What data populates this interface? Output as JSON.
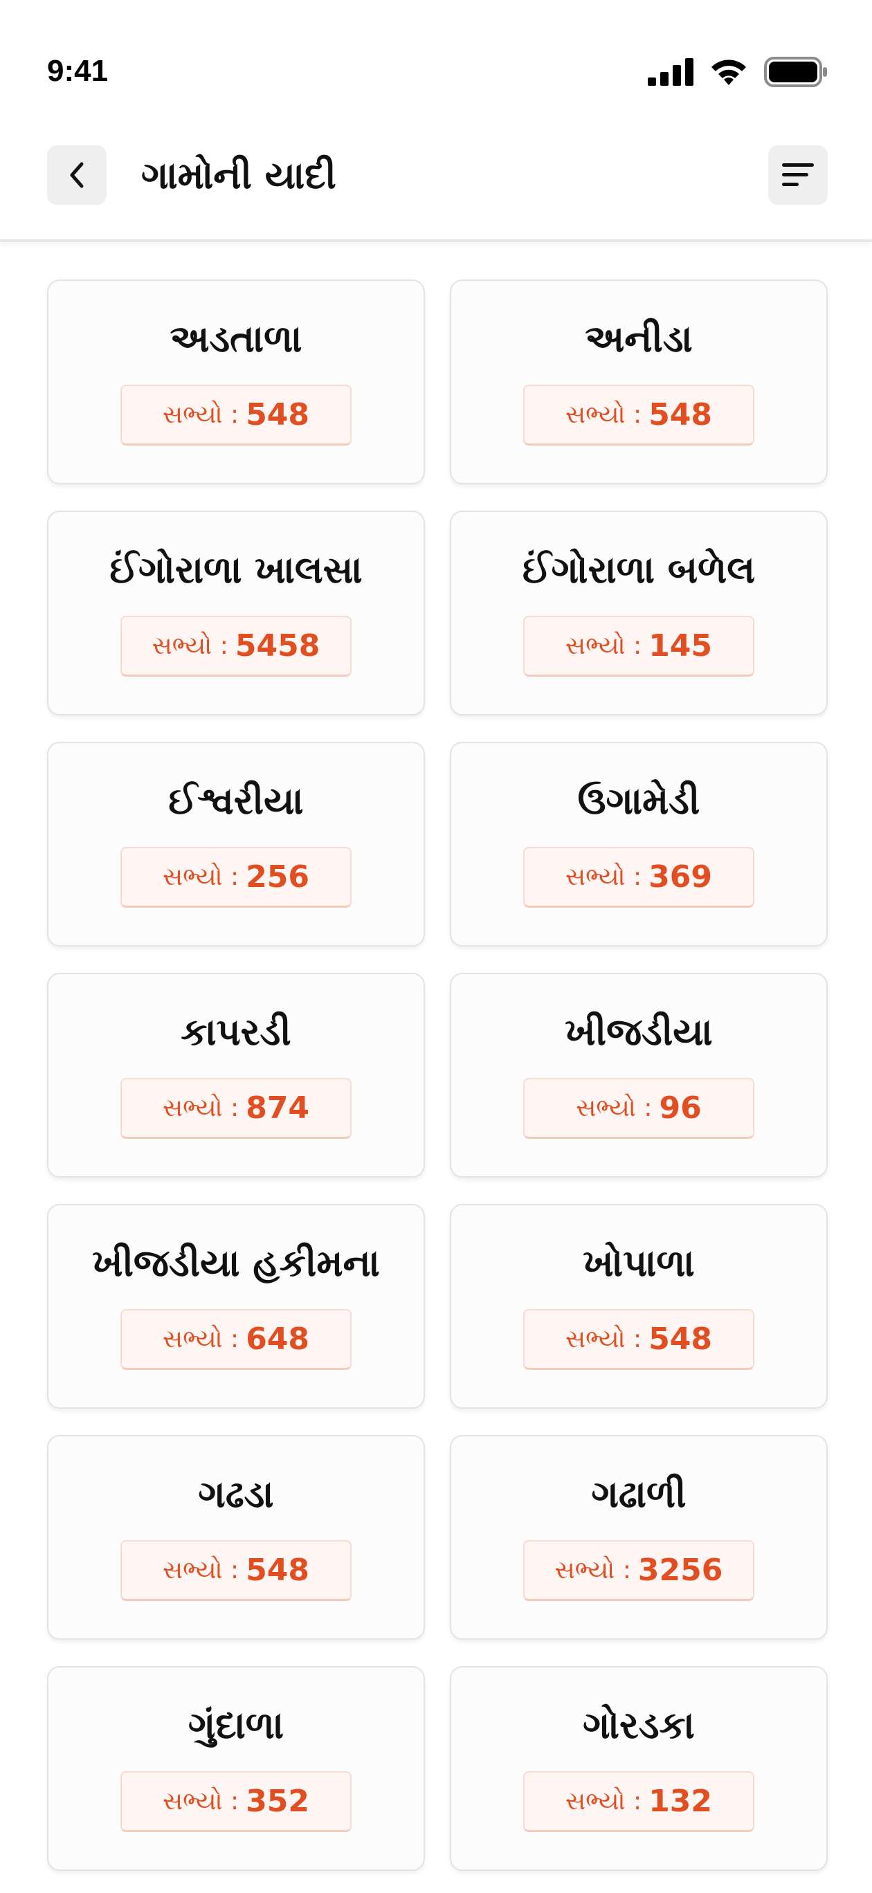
{
  "status_bar": {
    "time": "9:41"
  },
  "header": {
    "title": "ગામોની યાદી"
  },
  "colors": {
    "accent": "#e04e22",
    "count_bg": "#fff5f2",
    "button_bg": "#efefef"
  },
  "villages": [
    {
      "name": "અડતાળા",
      "members_label": "સભ્યો :",
      "members": "548"
    },
    {
      "name": "અનીડા",
      "members_label": "સભ્યો :",
      "members": "548"
    },
    {
      "name": "ઈંગોરાળા ખાલસા",
      "members_label": "સભ્યો :",
      "members": "5458"
    },
    {
      "name": "ઈંગોરાળા બળેલ",
      "members_label": "સભ્યો :",
      "members": "145"
    },
    {
      "name": "ઈશ્વરીયા",
      "members_label": "સભ્યો :",
      "members": "256"
    },
    {
      "name": "ઉગામેડી",
      "members_label": "સભ્યો :",
      "members": "369"
    },
    {
      "name": "કાપરડી",
      "members_label": "સભ્યો :",
      "members": "874"
    },
    {
      "name": "ખીજડીયા",
      "members_label": "સભ્યો :",
      "members": "96"
    },
    {
      "name": "ખીજડીયા હકીમના",
      "members_label": "સભ્યો :",
      "members": "648"
    },
    {
      "name": "ખોપાળા",
      "members_label": "સભ્યો :",
      "members": "548"
    },
    {
      "name": "ગઢડા",
      "members_label": "સભ્યો :",
      "members": "548"
    },
    {
      "name": "ગઢાળી",
      "members_label": "સભ્યો :",
      "members": "3256"
    },
    {
      "name": "ગુંદાળા",
      "members_label": "સભ્યો :",
      "members": "352"
    },
    {
      "name": "ગોરડકા",
      "members_label": "સભ્યો :",
      "members": "132"
    }
  ]
}
